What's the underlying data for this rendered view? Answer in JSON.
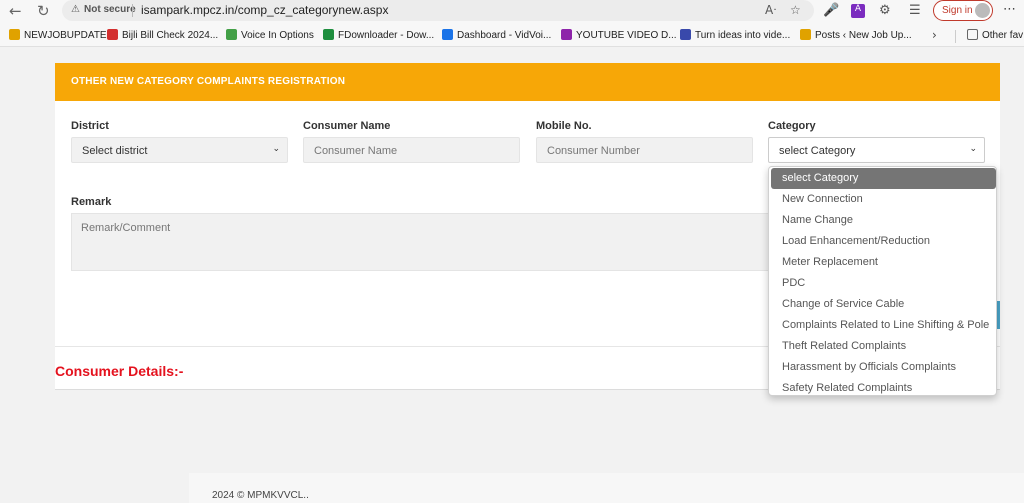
{
  "browser": {
    "security_label": "Not secure",
    "url": "isampark.mpcz.in/comp_cz_categorynew.aspx",
    "signin_label": "Sign in",
    "bookmarks": [
      {
        "label": "NEWJOBUPDATE",
        "color": "#e0a200"
      },
      {
        "label": "Bijli Bill Check 2024...",
        "color": "#d32f2f"
      },
      {
        "label": "Voice In Options",
        "color": "#43a047"
      },
      {
        "label": "FDownloader - Dow...",
        "color": "#1e8e3e"
      },
      {
        "label": "Dashboard - VidVoi...",
        "color": "#1a73e8"
      },
      {
        "label": "YOUTUBE VIDEO D...",
        "color": "#8e24aa"
      },
      {
        "label": "Turn ideas into vide...",
        "color": "#3949ab"
      },
      {
        "label": "Posts ‹ New Job Up...",
        "color": "#e0a200"
      },
      {
        "label": "Other fav",
        "color": "#666666"
      }
    ]
  },
  "form": {
    "title": "OTHER NEW CATEGORY COMPLAINTS REGISTRATION",
    "district_label": "District",
    "district_value": "Select district",
    "consumer_name_label": "Consumer Name",
    "consumer_name_placeholder": "Consumer Name",
    "mobile_label": "Mobile No.",
    "mobile_placeholder": "Consumer Number",
    "category_label": "Category",
    "category_value": "select Category",
    "remark_label": "Remark",
    "remark_placeholder": "Remark/Comment"
  },
  "category_options": [
    "select Category",
    "New Connection",
    "Name Change",
    "Load Enhancement/Reduction",
    "Meter Replacement",
    "PDC",
    "Change of Service Cable",
    "Complaints Related to Line Shifting & Pole",
    "Theft Related Complaints",
    "Harassment by Officials Complaints",
    "Safety Related Complaints"
  ],
  "consumer_details_label": "Consumer Details:-",
  "footer_text": "2024 © MPMKVVCL..",
  "colors": {
    "header_orange": "#f7a707",
    "consumer_details_red": "#e4121e",
    "selected_option_bg": "#757575"
  }
}
